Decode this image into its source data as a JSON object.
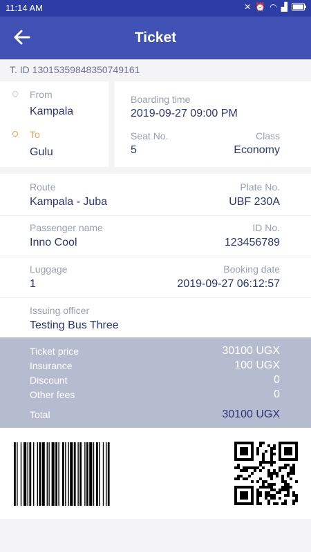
{
  "status_bar": {
    "time": "11:14 AM"
  },
  "header": {
    "title": "Ticket",
    "back_icon": "arrow-left-icon"
  },
  "ticket_id": "T. ID 13015359848350749161",
  "route_card": {
    "from_label": "From",
    "from_value": "Kampala",
    "to_label": "To",
    "to_value": "Gulu"
  },
  "boarding": {
    "time_label": "Boarding time",
    "time_value": "2019-09-27 09:00 PM",
    "seat_label": "Seat No.",
    "seat_value": "5",
    "class_label": "Class",
    "class_value": "Economy"
  },
  "details": {
    "route_label": "Route",
    "route_value": "Kampala - Juba",
    "plate_label": "Plate No.",
    "plate_value": "UBF 230A",
    "passenger_label": "Passenger name",
    "passenger_value": "Inno Cool",
    "id_label": "ID No.",
    "id_value": "123456789",
    "luggage_label": "Luggage",
    "luggage_value": "1",
    "booking_label": "Booking date",
    "booking_value": "2019-09-27 06:12:57",
    "officer_label": "Issuing officer",
    "officer_value": "Testing Bus Three"
  },
  "fees": {
    "ticket_price_label": "Ticket price",
    "ticket_price_value": "30100 UGX",
    "insurance_label": "Insurance",
    "insurance_value": "100 UGX",
    "discount_label": "Discount",
    "discount_value": "0",
    "other_label": "Other fees",
    "other_value": "0",
    "total_label": "Total",
    "total_value": "30100 UGX"
  },
  "colors": {
    "primary": "#3f51b5",
    "status": "#2c3ea5",
    "accent": "#f0a04b",
    "fee_bg": "#b5bccf",
    "text_dark": "#2a3575"
  }
}
